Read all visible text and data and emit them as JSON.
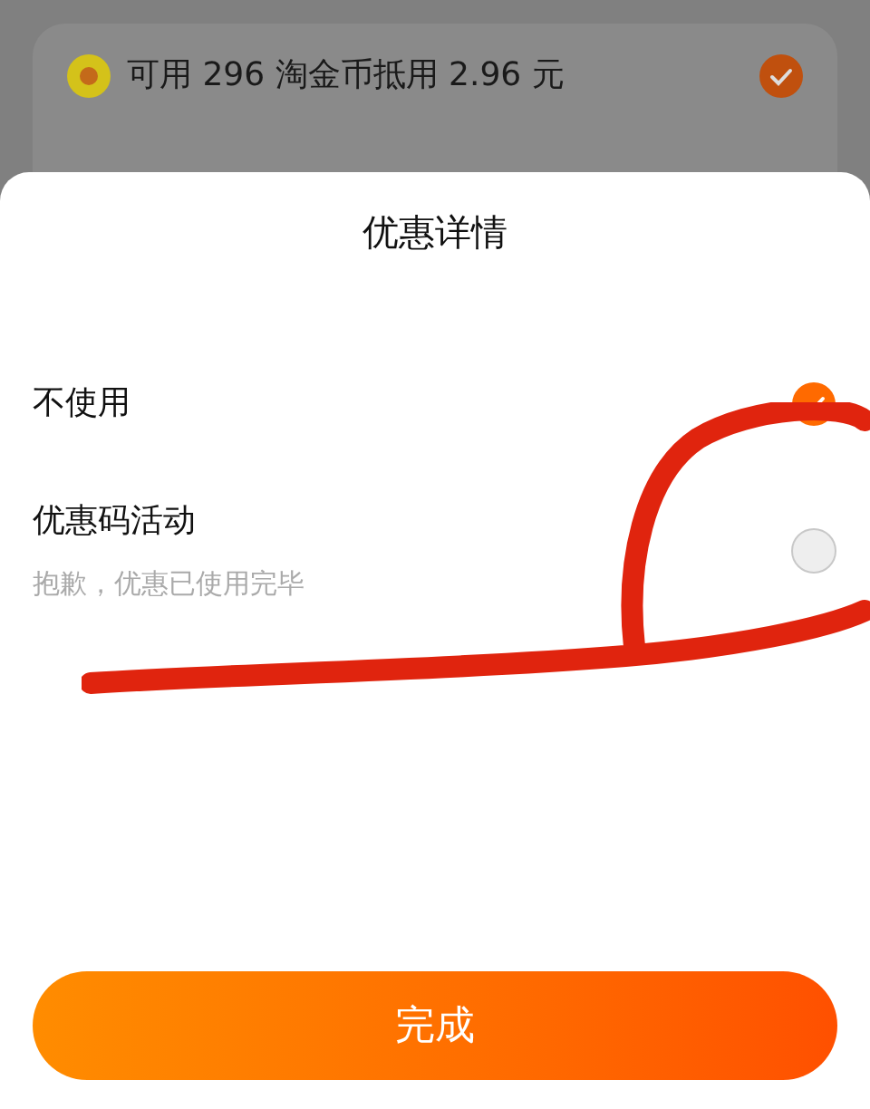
{
  "background_card": {
    "coin_row": {
      "label": "可用 296 淘金币抵用 2.96 元",
      "checked": true
    }
  },
  "sheet": {
    "title": "优惠详情",
    "options": [
      {
        "label": "不使用",
        "selected": true
      },
      {
        "label": "优惠码活动",
        "note": "抱歉，优惠已使用完毕",
        "selected": false
      }
    ],
    "done_button": "完成"
  }
}
